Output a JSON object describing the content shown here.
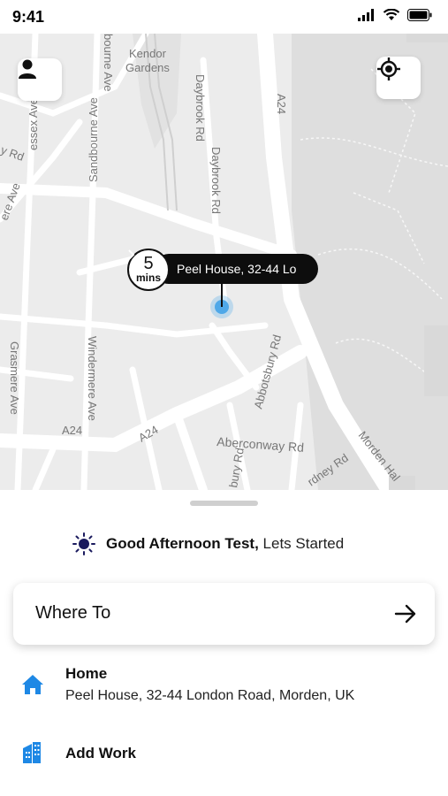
{
  "status_bar": {
    "time": "9:41"
  },
  "colors": {
    "accent": "#1e88e5",
    "pin_dot": "#4fa8e8",
    "sun": "#1a1a5e"
  },
  "map": {
    "labels": [
      "Kendor",
      "Gardens",
      "Daybrook Rd",
      "Daybrook Rd",
      "A24",
      "Sandbourne Ave",
      "essex Ave",
      "y Rd",
      "ere Ave",
      "Windermere Ave",
      "Grasmere Ave",
      "Abbotsbury Rd",
      "A24",
      "A24",
      "Aberconway Rd",
      "rdney Rd",
      "Morden Hal",
      "bury Rd",
      "bourne Ave"
    ],
    "pin": {
      "eta_value": "5",
      "eta_unit": "mins",
      "address": "Peel House, 32-44 Lo"
    }
  },
  "greeting": {
    "bold": "Good Afternoon Test,",
    "rest": " Lets Started"
  },
  "search": {
    "label": "Where To"
  },
  "places": [
    {
      "title": "Home",
      "subtitle": "Peel House, 32-44 London Road, Morden, UK",
      "icon": "home-icon"
    },
    {
      "title": "Add Work",
      "icon": "work-building-icon"
    }
  ]
}
